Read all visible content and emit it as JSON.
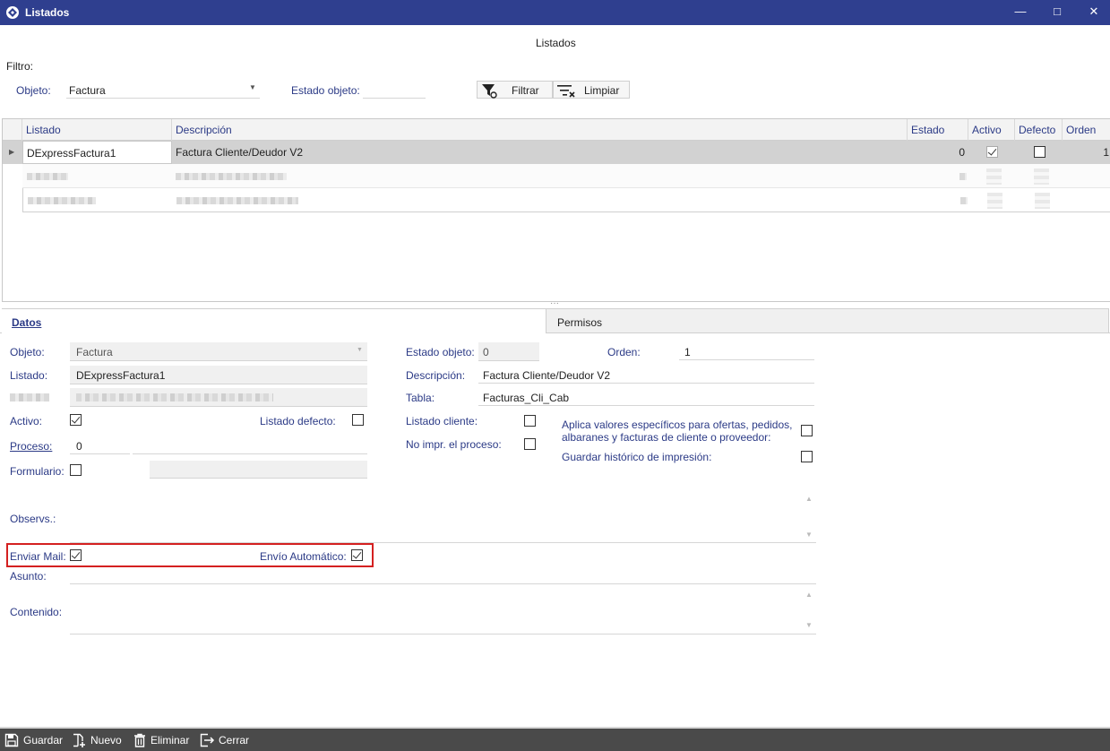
{
  "window": {
    "title": "Listados",
    "header": "Listados"
  },
  "filter": {
    "label": "Filtro:",
    "objeto_label": "Objeto:",
    "objeto_value": "Factura",
    "estado_label": "Estado objeto:",
    "estado_value": "",
    "filtrar_label": "Filtrar",
    "limpiar_label": "Limpiar"
  },
  "grid": {
    "columns": [
      "Listado",
      "Descripción",
      "Estado",
      "Activo",
      "Defecto",
      "Orden"
    ],
    "rows": [
      {
        "listado": "DExpressFactura1",
        "descripcion": "Factura Cliente/Deudor V2",
        "estado": "0",
        "activo": true,
        "defecto": false,
        "orden": "1"
      }
    ]
  },
  "tabs": {
    "datos": "Datos",
    "permisos": "Permisos"
  },
  "form": {
    "objeto_label": "Objeto:",
    "objeto_value": "Factura",
    "listado_label": "Listado:",
    "listado_value": "DExpressFactura1",
    "activo_label": "Activo:",
    "activo_checked": true,
    "listado_defecto_label": "Listado defecto:",
    "listado_defecto_checked": false,
    "proceso_label": "Proceso:",
    "proceso_value": "0",
    "formulario_label": "Formulario:",
    "formulario_checked": false,
    "estado_objeto_label": "Estado objeto:",
    "estado_objeto_value": "0",
    "orden_label": "Orden:",
    "orden_value": "1",
    "descripcion_label": "Descripción:",
    "descripcion_value": "Factura Cliente/Deudor V2",
    "tabla_label": "Tabla:",
    "tabla_value": "Facturas_Cli_Cab",
    "listado_cliente_label": "Listado cliente:",
    "listado_cliente_checked": false,
    "no_impr_label": "No impr. el proceso:",
    "no_impr_checked": false,
    "aplica_label_1": "Aplica valores específicos para ofertas, pedidos,",
    "aplica_label_2": "albaranes y facturas de cliente o proveedor:",
    "aplica_checked": false,
    "guardar_historico_label": "Guardar histórico de impresión:",
    "guardar_historico_checked": false,
    "observs_label": "Observs.:",
    "enviar_mail_label": "Enviar Mail:",
    "enviar_mail_checked": true,
    "envio_auto_label": "Envío Automático:",
    "envio_auto_checked": true,
    "asunto_label": "Asunto:",
    "contenido_label": "Contenido:"
  },
  "bottom_toolbar": {
    "guardar": "Guardar",
    "nuevo": "Nuevo",
    "eliminar": "Eliminar",
    "cerrar": "Cerrar"
  },
  "colors": {
    "titlebar": "#2f3f8f",
    "label_blue": "#2b3a86",
    "highlight": "#d42020",
    "toolbar": "#4a4a4a"
  }
}
